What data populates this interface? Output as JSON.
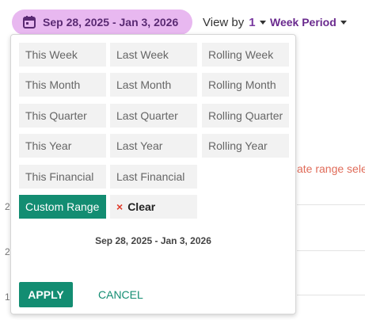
{
  "header": {
    "date_range": "Sep 28, 2025 - Jan 3, 2026",
    "view_by_label": "View by",
    "view_by_value": "1",
    "period_label": "Week Period"
  },
  "background": {
    "red_text": "ate range selec",
    "row_nums": [
      "2",
      "2",
      "1"
    ]
  },
  "picker": {
    "options": [
      "This Week",
      "Last Week",
      "Rolling Week",
      "This Month",
      "Last Month",
      "Rolling Month",
      "This Quarter",
      "Last Quarter",
      "Rolling Quarter",
      "This Year",
      "Last Year",
      "Rolling Year",
      "This Financial",
      "Last Financial"
    ],
    "custom_range": "Custom Range",
    "clear_label": "Clear",
    "clear_symbol": "×",
    "selected_range": "Sep 28, 2025 - Jan 3, 2026",
    "apply_label": "APPLY",
    "cancel_label": "CANCEL"
  },
  "colors": {
    "accent": "#138d72",
    "pill": "#e8b8f0",
    "purple": "#6a2a8e",
    "clear_x": "#e03a2a"
  }
}
